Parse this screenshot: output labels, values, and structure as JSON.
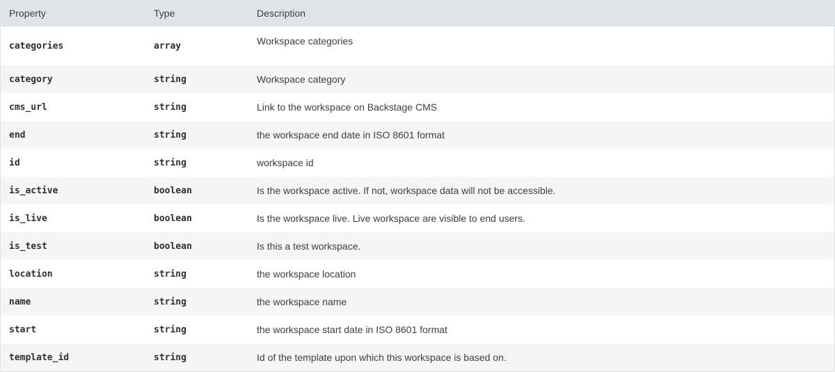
{
  "table": {
    "headers": {
      "property": "Property",
      "type": "Type",
      "description": "Description"
    },
    "rows": [
      {
        "property": "categories",
        "type": "array",
        "description": "Workspace categories"
      },
      {
        "property": "category",
        "type": "string",
        "description": "Workspace category"
      },
      {
        "property": "cms_url",
        "type": "string",
        "description": "Link to the workspace on Backstage CMS"
      },
      {
        "property": "end",
        "type": "string",
        "description": "the workspace end date in ISO 8601 format"
      },
      {
        "property": "id",
        "type": "string",
        "description": "workspace id"
      },
      {
        "property": "is_active",
        "type": "boolean",
        "description": "Is the workspace active. If not, workspace data will not be accessible."
      },
      {
        "property": "is_live",
        "type": "boolean",
        "description": "Is the workspace live. Live workspace are visible to end users."
      },
      {
        "property": "is_test",
        "type": "boolean",
        "description": "Is this a test workspace."
      },
      {
        "property": "location",
        "type": "string",
        "description": "the workspace location"
      },
      {
        "property": "name",
        "type": "string",
        "description": "the workspace name"
      },
      {
        "property": "start",
        "type": "string",
        "description": "the workspace start date in ISO 8601 format"
      },
      {
        "property": "template_id",
        "type": "string",
        "description": "Id of the template upon which this workspace is based on."
      }
    ]
  }
}
